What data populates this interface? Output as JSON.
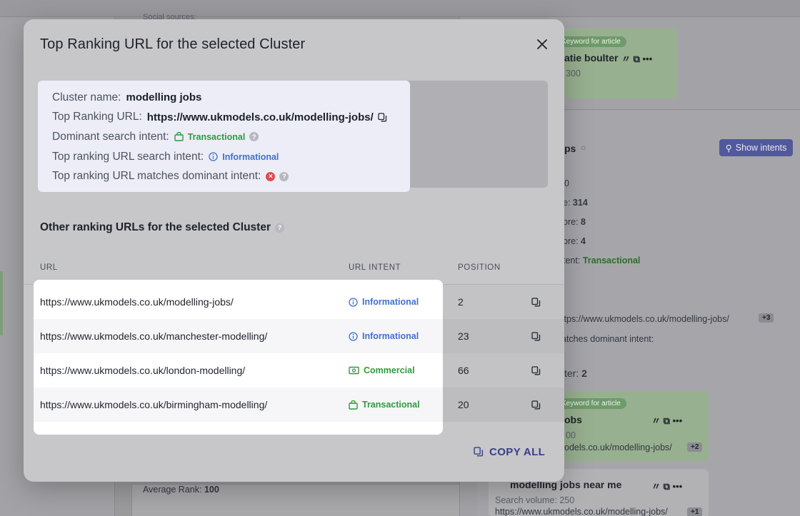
{
  "modal": {
    "title": "Top Ranking URL for the selected Cluster",
    "summary": {
      "cluster_name_label": "Cluster name:",
      "cluster_name_value": "modelling jobs",
      "top_url_label": "Top Ranking URL:",
      "top_url_value": "https://www.ukmodels.co.uk/modelling-jobs/",
      "dominant_intent_label": "Dominant search intent:",
      "dominant_intent_value": "Transactional",
      "top_url_intent_label": "Top ranking URL search intent:",
      "top_url_intent_value": "Informational",
      "matches_label": "Top ranking URL matches dominant intent:"
    },
    "other_section_title": "Other ranking URLs for the selected Cluster",
    "table": {
      "headers": {
        "url": "URL",
        "intent": "URL INTENT",
        "position": "POSITION"
      },
      "rows": [
        {
          "url": "https://www.ukmodels.co.uk/modelling-jobs/",
          "intent": "Informational",
          "position": "2"
        },
        {
          "url": "https://www.ukmodels.co.uk/manchester-modelling/",
          "intent": "Informational",
          "position": "23"
        },
        {
          "url": "https://www.ukmodels.co.uk/london-modelling/",
          "intent": "Commercial",
          "position": "66"
        },
        {
          "url": "https://www.ukmodels.co.uk/birmingham-modelling/",
          "intent": "Transactional",
          "position": "20"
        }
      ]
    },
    "copy_all_label": "COPY ALL"
  },
  "background": {
    "top_label": "Social sources:",
    "badge1": "Keyword for article",
    "card1_keyword": "atie boulter",
    "card1_volume": "300",
    "section_heading": "ps",
    "show_intents_label": "Show intents",
    "stat1": "0",
    "stat2_label": "e:",
    "stat2_value": "314",
    "stat3_label": "ore:",
    "stat3_value": "8",
    "stat4_label": "ore:",
    "stat4_value": "4",
    "intent_label": "tent:",
    "intent_value": "Transactional",
    "url_row": "ttps://www.ukmodels.co.uk/modelling-jobs/",
    "url_count": "+3",
    "matches_row": "atches dominant intent:",
    "cluster_label": "ter:",
    "cluster_value": "2",
    "badge2": "Keyword for article",
    "card2_keyword": "obs",
    "card2_volume": "00",
    "card2_url": "odels.co.uk/modelling-jobs/",
    "card2_count": "+2",
    "card3_keyword": "modelling jobs near me",
    "card3_volume": "Search volume: 250",
    "card3_url": "https://www.ukmodels.co.uk/modelling-jobs/",
    "card3_count": "+1",
    "avg_rank_label": "Average Rank:",
    "avg_rank_value": "100"
  },
  "colors": {
    "transactional": "#2f9a3f",
    "informational": "#3f72c9",
    "commercial": "#2f9a3f",
    "copy_all": "#3a3f86",
    "error": "#e24b4b"
  }
}
